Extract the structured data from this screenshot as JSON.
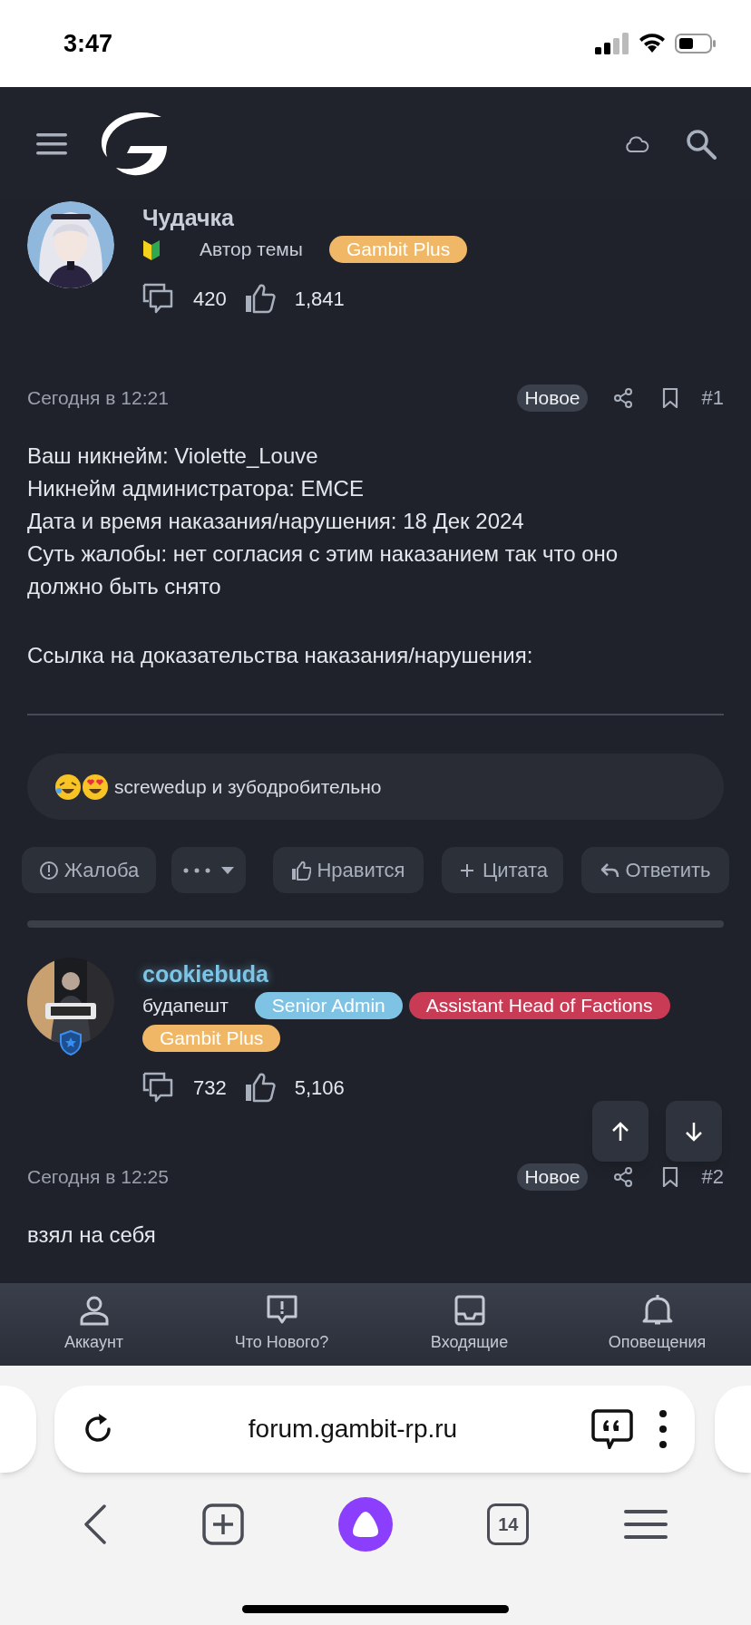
{
  "status_bar": {
    "time": "3:47"
  },
  "posts": [
    {
      "author": "Чудачка",
      "highlighted": false,
      "beginner": true,
      "user_title": "Автор темы",
      "banners": [
        {
          "label": "Gambit Plus",
          "color": "#f0b866"
        }
      ],
      "messages": "420",
      "likes": "1,841",
      "date": "Сегодня в 12:21",
      "badge": "Новое",
      "number": "#1",
      "paragraphs": [
        [
          "Ваш никнейм: Violette_Louve",
          "Никнейм администратора: EMCE",
          "Дата и время наказания/нарушения: 18 Дек 2024",
          "Суть жалобы: нет согласия с этим наказанием так что оно должно быть снято"
        ],
        [
          "Ссылка на доказательства наказания/нарушения:"
        ]
      ],
      "signature_rule": true,
      "reactions": "screwedup и зубодробительно",
      "actions": [
        {
          "kind": "report",
          "label": "Жалоба"
        },
        {
          "kind": "more"
        },
        {
          "kind": "like",
          "label": "Нравится"
        },
        {
          "kind": "quote",
          "label": "Цитата"
        },
        {
          "kind": "reply",
          "label": "Ответить"
        }
      ]
    },
    {
      "author": "cookiebuda",
      "highlighted": true,
      "staff_badge": true,
      "user_title": "будапешт",
      "banners": [
        {
          "label": "Senior Admin",
          "color": "#7ec3e3"
        },
        {
          "label": "Assistant Head of Factions",
          "color": "#c93a55"
        },
        {
          "label": "Gambit Plus",
          "color": "#f0b866"
        }
      ],
      "messages": "732",
      "likes": "5,106",
      "date": "Сегодня в 12:25",
      "badge": "Новое",
      "number": "#2",
      "paragraphs": [
        [
          "взял на себя"
        ]
      ]
    }
  ],
  "bottom_nav": [
    {
      "kind": "account",
      "label": "Аккаунт"
    },
    {
      "kind": "whats_new",
      "label": "Что Нового?"
    },
    {
      "kind": "inbox",
      "label": "Входящие"
    },
    {
      "kind": "alerts",
      "label": "Оповещения"
    }
  ],
  "browser": {
    "url": "forum.gambit-rp.ru",
    "tab_count": "14"
  }
}
